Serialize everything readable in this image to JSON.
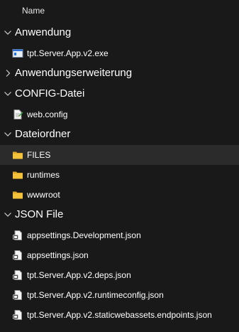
{
  "header": {
    "column_name": "Name"
  },
  "groups": [
    {
      "label": "Anwendung",
      "expanded": true,
      "items": [
        {
          "label": "tpt.Server.App.v2.exe",
          "icon": "application-exe-icon"
        }
      ]
    },
    {
      "label": "Anwendungserweiterung",
      "expanded": false,
      "items": []
    },
    {
      "label": "CONFIG-Datei",
      "expanded": true,
      "items": [
        {
          "label": "web.config",
          "icon": "config-file-icon"
        }
      ]
    },
    {
      "label": "Dateiordner",
      "expanded": true,
      "items": [
        {
          "label": "FILES",
          "icon": "folder-icon",
          "selected": true
        },
        {
          "label": "runtimes",
          "icon": "folder-icon"
        },
        {
          "label": "wwwroot",
          "icon": "folder-icon"
        }
      ]
    },
    {
      "label": "JSON File",
      "expanded": true,
      "items": [
        {
          "label": "appsettings.Development.json",
          "icon": "json-file-icon"
        },
        {
          "label": "appsettings.json",
          "icon": "json-file-icon"
        },
        {
          "label": "tpt.Server.App.v2.deps.json",
          "icon": "json-file-icon"
        },
        {
          "label": "tpt.Server.App.v2.runtimeconfig.json",
          "icon": "json-file-icon"
        },
        {
          "label": "tpt.Server.App.v2.staticwebassets.endpoints.json",
          "icon": "json-file-icon"
        }
      ]
    }
  ],
  "colors": {
    "background": "#191919",
    "selected_row": "#2b2b2b",
    "text": "#ffffff",
    "folder": "#f3c13a"
  }
}
